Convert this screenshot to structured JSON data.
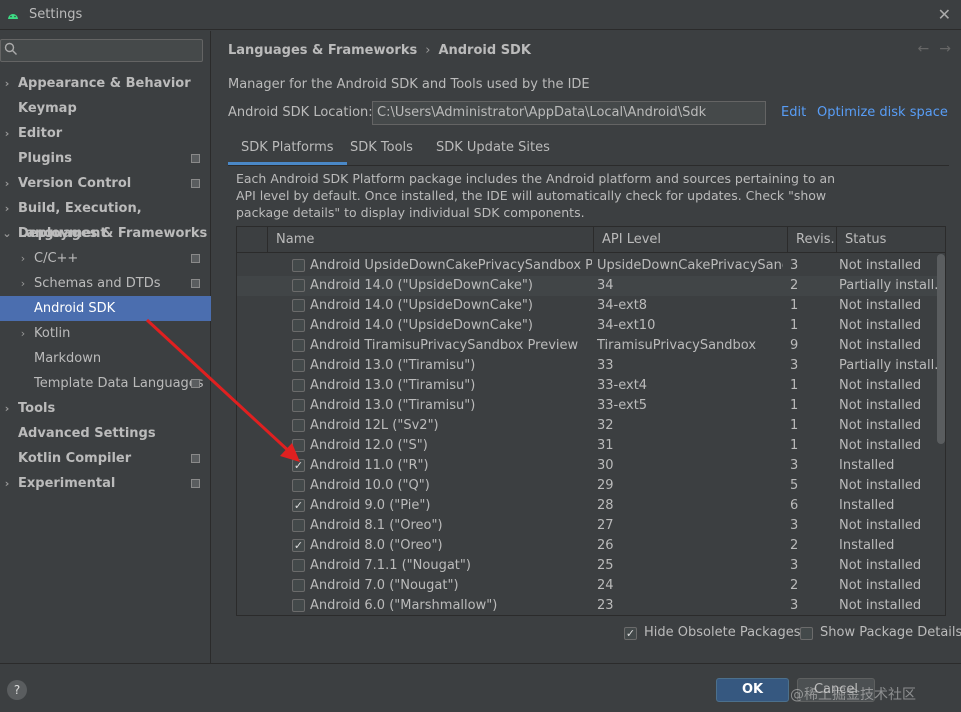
{
  "window": {
    "title": "Settings",
    "close_glyph": "✕",
    "app_icon": "android-icon"
  },
  "sidebar": {
    "search_placeholder": "",
    "items": [
      {
        "label": "Appearance & Behavior",
        "chev": "›",
        "bold": true
      },
      {
        "label": "Keymap",
        "bold": true
      },
      {
        "label": "Editor",
        "chev": "›",
        "bold": true
      },
      {
        "label": "Plugins",
        "bold": true,
        "badge": true
      },
      {
        "label": "Version Control",
        "chev": "›",
        "bold": true,
        "badge": true
      },
      {
        "label": "Build, Execution, Deployment",
        "chev": "›",
        "bold": true
      },
      {
        "label": "Languages & Frameworks",
        "chev": "⌄",
        "bold": true
      },
      {
        "label": "C/C++",
        "chev": "›",
        "badge": true
      },
      {
        "label": "Schemas and DTDs",
        "chev": "›",
        "badge": true
      },
      {
        "label": "Android SDK",
        "selected": true
      },
      {
        "label": "Kotlin",
        "chev": "›"
      },
      {
        "label": "Markdown"
      },
      {
        "label": "Template Data Languages",
        "badge": true
      },
      {
        "label": "Tools",
        "chev": "›",
        "bold": true
      },
      {
        "label": "Advanced Settings",
        "bold": true
      },
      {
        "label": "Kotlin Compiler",
        "bold": true,
        "badge": true
      },
      {
        "label": "Experimental",
        "chev": "›",
        "bold": true,
        "badge": true
      }
    ]
  },
  "main": {
    "breadcrumb": [
      "Languages & Frameworks",
      "Android SDK"
    ],
    "breadcrumb_sep": "›",
    "back_glyph": "←",
    "forward_glyph": "→",
    "description": "Manager for the Android SDK and Tools used by the IDE",
    "location_label": "Android SDK Location:",
    "location_value": "C:\\Users\\Administrator\\AppData\\Local\\Android\\Sdk",
    "edit_link": "Edit",
    "optimize_link": "Optimize disk space",
    "tabs": [
      "SDK Platforms",
      "SDK Tools",
      "SDK Update Sites"
    ],
    "active_tab": 0,
    "panel_text": "Each Android SDK Platform package includes the Android platform and sources pertaining to an API level by default. Once installed, the IDE will automatically check for updates. Check \"show package details\" to display individual SDK components.",
    "table": {
      "columns": [
        "Name",
        "API Level",
        "Revis...",
        "Status"
      ],
      "rows": [
        {
          "checked": false,
          "name": "Android UpsideDownCakePrivacySandbox Preview",
          "api": "UpsideDownCakePrivacySand...",
          "rev": "3",
          "status": "Not installed"
        },
        {
          "checked": false,
          "name": "Android 14.0 (\"UpsideDownCake\")",
          "api": "34",
          "rev": "2",
          "status": "Partially install..."
        },
        {
          "checked": false,
          "name": "Android 14.0 (\"UpsideDownCake\")",
          "api": "34-ext8",
          "rev": "1",
          "status": "Not installed"
        },
        {
          "checked": false,
          "name": "Android 14.0 (\"UpsideDownCake\")",
          "api": "34-ext10",
          "rev": "1",
          "status": "Not installed"
        },
        {
          "checked": false,
          "name": "Android TiramisuPrivacySandbox Preview",
          "api": "TiramisuPrivacySandbox",
          "rev": "9",
          "status": "Not installed"
        },
        {
          "checked": false,
          "name": "Android 13.0 (\"Tiramisu\")",
          "api": "33",
          "rev": "3",
          "status": "Partially install..."
        },
        {
          "checked": false,
          "name": "Android 13.0 (\"Tiramisu\")",
          "api": "33-ext4",
          "rev": "1",
          "status": "Not installed"
        },
        {
          "checked": false,
          "name": "Android 13.0 (\"Tiramisu\")",
          "api": "33-ext5",
          "rev": "1",
          "status": "Not installed"
        },
        {
          "checked": false,
          "name": "Android 12L (\"Sv2\")",
          "api": "32",
          "rev": "1",
          "status": "Not installed"
        },
        {
          "checked": false,
          "name": "Android 12.0 (\"S\")",
          "api": "31",
          "rev": "1",
          "status": "Not installed"
        },
        {
          "checked": true,
          "name": "Android 11.0 (\"R\")",
          "api": "30",
          "rev": "3",
          "status": "Installed"
        },
        {
          "checked": false,
          "name": "Android 10.0 (\"Q\")",
          "api": "29",
          "rev": "5",
          "status": "Not installed"
        },
        {
          "checked": true,
          "name": "Android 9.0 (\"Pie\")",
          "api": "28",
          "rev": "6",
          "status": "Installed"
        },
        {
          "checked": false,
          "name": "Android 8.1 (\"Oreo\")",
          "api": "27",
          "rev": "3",
          "status": "Not installed"
        },
        {
          "checked": true,
          "name": "Android 8.0 (\"Oreo\")",
          "api": "26",
          "rev": "2",
          "status": "Installed"
        },
        {
          "checked": false,
          "name": "Android 7.1.1 (\"Nougat\")",
          "api": "25",
          "rev": "3",
          "status": "Not installed"
        },
        {
          "checked": false,
          "name": "Android 7.0 (\"Nougat\")",
          "api": "24",
          "rev": "2",
          "status": "Not installed"
        },
        {
          "checked": false,
          "name": "Android 6.0 (\"Marshmallow\")",
          "api": "23",
          "rev": "3",
          "status": "Not installed"
        }
      ]
    },
    "hide_obsolete": {
      "label": "Hide Obsolete Packages",
      "checked": true
    },
    "show_details": {
      "label": "Show Package Details",
      "checked": false
    }
  },
  "footer": {
    "help": "?",
    "ok": "OK",
    "cancel": "Cancel",
    "watermark": "@稀土掘金技术社区"
  },
  "annotation": {
    "arrow_color": "#e02020"
  },
  "check_glyph": "✓"
}
